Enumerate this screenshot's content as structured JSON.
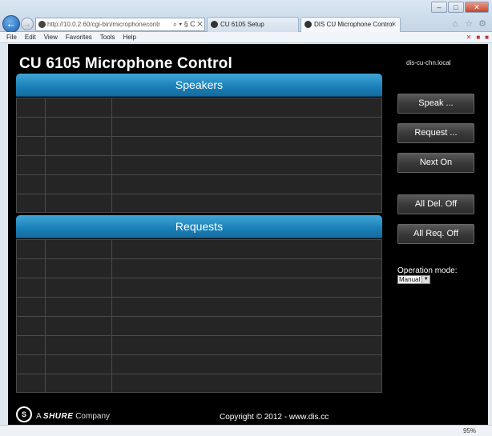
{
  "browser": {
    "address": "http://10.0.2.60/cgi-bin/microphonecontr",
    "address_controls": "⌕ ▾ § C ✕",
    "tabs": [
      {
        "label": "CU 6105 Setup"
      },
      {
        "label": "DIS CU Microphone Control",
        "close": "✕"
      }
    ],
    "menu": [
      "File",
      "Edit",
      "View",
      "Favorites",
      "Tools",
      "Help"
    ],
    "zoom": "95%"
  },
  "page": {
    "title": "CU 6105 Microphone Control",
    "host": "dis-cu-chn.local"
  },
  "speakers": {
    "header": "Speakers",
    "rows": 6
  },
  "requests": {
    "header": "Requests",
    "rows": 8
  },
  "buttons": {
    "speak": "Speak ...",
    "request": "Request ...",
    "next_on": "Next On",
    "all_del_off": "All Del. Off",
    "all_req_off": "All Req. Off"
  },
  "operation_mode": {
    "label": "Operation mode:",
    "value": "Manual"
  },
  "footer": {
    "brand_prefix": "A",
    "brand": "SHURE",
    "brand_suffix": "Company",
    "copyright": "Copyright © 2012 - www.dis.cc"
  }
}
